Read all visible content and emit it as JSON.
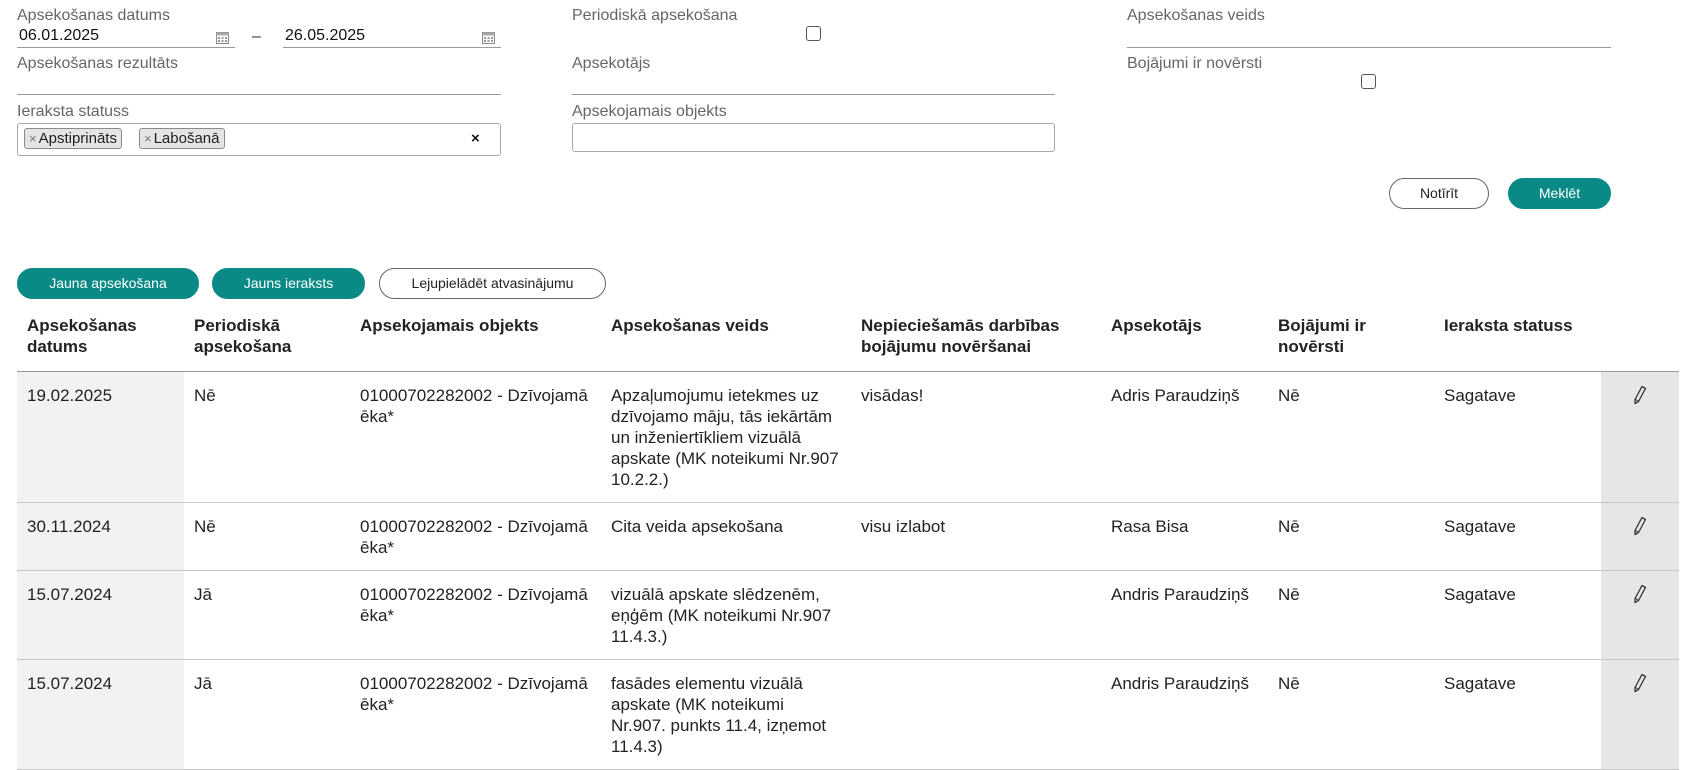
{
  "filters": {
    "date_label": "Apsekošanas datums",
    "date_from": "06.01.2025",
    "date_to": "26.05.2025",
    "date_separator": "–",
    "periodic_label": "Periodiskā apsekošana",
    "type_label": "Apsekošanas veids",
    "result_label": "Apsekošanas rezultāts",
    "inspector_label": "Apsekotājs",
    "damage_label": "Bojājumi ir novērsti",
    "status_label": "Ieraksta statuss",
    "status_tags": [
      "Apstiprināts",
      "Labošanā"
    ],
    "object_label": "Apsekojamais objekts",
    "clear_button": "Notīrīt",
    "search_button": "Meklēt"
  },
  "actions": {
    "new_inspection": "Jauna apsekošana",
    "new_record": "Jauns ieraksts",
    "download_extract": "Lejupielādēt atvasinājumu"
  },
  "table": {
    "headers": [
      "Apsekošanas datums",
      "Periodiskā apsekošana",
      "Apsekojamais objekts",
      "Apsekošanas veids",
      "Nepieciešamās darbības bojājumu novēršanai",
      "Apsekotājs",
      "Bojājumi ir novērsti",
      "Ieraksta statuss"
    ],
    "rows": [
      [
        "19.02.2025",
        "Nē",
        "01000702282002 - Dzīvojamā ēka*",
        "Apzaļumojumu ietekmes uz dzīvojamo māju, tās iekārtām un inženiertīkliem vizuālā apskate (MK noteikumi Nr.907 10.2.2.)",
        "visādas!",
        "Adris Paraudziņš",
        "Nē",
        "Sagatave"
      ],
      [
        "30.11.2024",
        "Nē",
        "01000702282002 - Dzīvojamā ēka*",
        "Cita veida apsekošana",
        "visu izlabot",
        "Rasa Bisa",
        "Nē",
        "Sagatave"
      ],
      [
        "15.07.2024",
        "Jā",
        "01000702282002 - Dzīvojamā ēka*",
        "vizuālā apskate slēdzenēm, eņģēm (MK noteikumi Nr.907 11.4.3.)",
        "",
        "Andris Paraudziņš",
        "Nē",
        "Sagatave"
      ],
      [
        "15.07.2024",
        "Jā",
        "01000702282002 - Dzīvojamā ēka*",
        "fasādes elementu vizuālā apskate (MK noteikumi Nr.907. punkts 11.4, izņemot 11.4.3)",
        "",
        "Andris Paraudziņš",
        "Nē",
        "Sagatave"
      ]
    ]
  },
  "icons": {
    "calendar": "calendar-icon",
    "edit": "pencil-icon",
    "remove": "close-icon"
  },
  "colors": {
    "accent": "#0a8a86",
    "row_shade": "#f2f2f2",
    "action_shade": "#e6e6e6"
  }
}
